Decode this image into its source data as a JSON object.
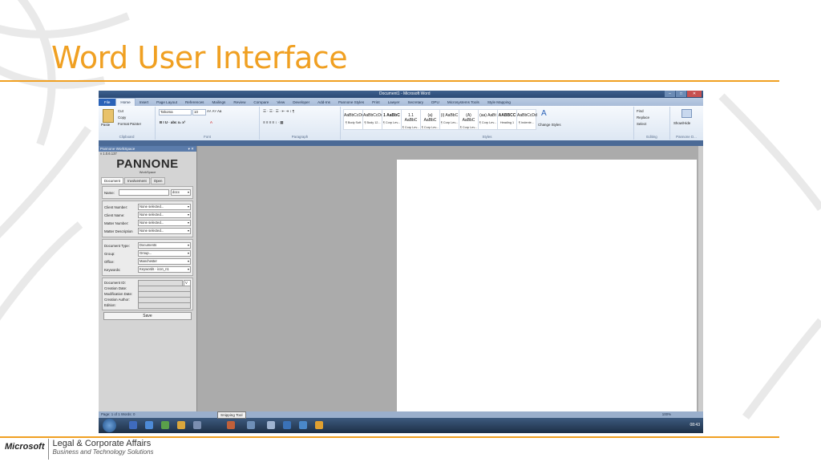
{
  "slide": {
    "title": "Word User Interface",
    "footer_logo": "Microsoft",
    "footer_line1": "Legal & Corporate Affairs",
    "footer_line2": "Business and Technology Solutions",
    "accent_color": "#f0a022"
  },
  "word": {
    "window_title": "Document1 - Microsoft Word",
    "tabs": [
      "File",
      "Home",
      "Insert",
      "Page Layout",
      "References",
      "Mailings",
      "Review",
      "Compare",
      "View",
      "Developer",
      "Add-Ins",
      "Pannone Styles",
      "Print",
      "Lawyer",
      "Secretary",
      "DPU",
      "Microsystems Tools",
      "Style Mapping"
    ],
    "clipboard": {
      "cut": "Cut",
      "copy": "Copy",
      "paste": "Paste",
      "format_painter": "Format Painter",
      "label": "Clipboard"
    },
    "font": {
      "name": "Tahoma",
      "size": "10",
      "label": "Font"
    },
    "paragraph_label": "Paragraph",
    "styles": [
      {
        "sample": "AaBbCcDd",
        "name": "¶ Body Soft"
      },
      {
        "sample": "AaBbCcDd",
        "name": "¶ Body 12..."
      },
      {
        "sample": "1 AaBbC",
        "name": "¶ Corp Lev..."
      },
      {
        "sample": "1.1 AaBbC",
        "name": "¶ Corp Lev..."
      },
      {
        "sample": "(a) AaBbC",
        "name": "¶ Corp Lev..."
      },
      {
        "sample": "(i) AaBbC",
        "name": "¶ Corp Lev..."
      },
      {
        "sample": "(A) AaBbC",
        "name": "¶ Corp Lev..."
      },
      {
        "sample": "(aa) AaBt",
        "name": "¶ Corp Lev..."
      },
      {
        "sample": "AABBCC",
        "name": "Heading 1"
      },
      {
        "sample": "AaBbCcDd",
        "name": "¶ Indente..."
      }
    ],
    "styles_label": "Styles",
    "change_styles": "Change Styles",
    "editing": {
      "find": "Find",
      "replace": "Replace",
      "select": "Select",
      "label": "Editing"
    },
    "showhide": "Show/Hide",
    "pannone_group": "Pannone D...",
    "status_left": "Page: 1 of 1   Words: 0",
    "status_zoom": "100%",
    "tooltip": "Snipping Tool",
    "clock": "08:43"
  },
  "workspace": {
    "title": "Pannone WorkSpace",
    "version": "v 1.0.6.137",
    "brand": "PANNONE",
    "brand_sub": "WorkSpace",
    "tabs": [
      "Document",
      "Involvement",
      "Open"
    ],
    "name_label": "Name:",
    "name_ext": "docx",
    "client_number_label": "Client Number:",
    "client_number": "None selected...",
    "client_name_label": "Client Name:",
    "client_name": "None selected...",
    "matter_number_label": "Matter Number:",
    "matter_number": "None selected...",
    "matter_desc_label": "Matter Description",
    "matter_desc": "None selected...",
    "doc_type_label": "Document Type:",
    "doc_type": "Documents",
    "group_label": "Group:",
    "group": "Group...",
    "office_label": "Office:",
    "office": "Manchester",
    "keywords_label": "Keywords:",
    "keywords": "Keywords - icon_n1",
    "doc_id_label": "Document ID:",
    "doc_id_ver": "V",
    "creation_date_label": "Creation Date:",
    "mod_date_label": "Modification Date:",
    "creation_author_label": "Creation Author:",
    "edition_label": "Edition:",
    "save": "Save"
  }
}
